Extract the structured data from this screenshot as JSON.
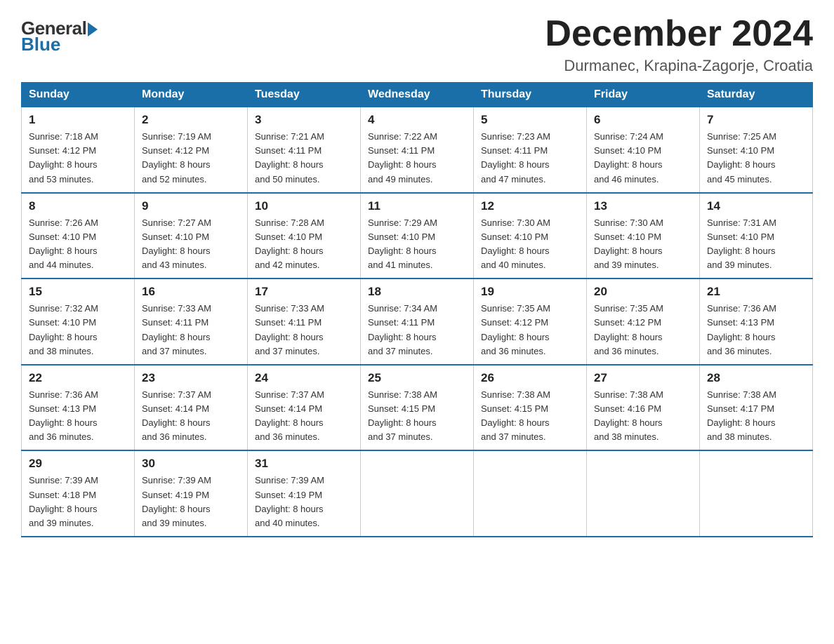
{
  "header": {
    "logo_general": "General",
    "logo_blue": "Blue",
    "month_title": "December 2024",
    "location": "Durmanec, Krapina-Zagorje, Croatia"
  },
  "weekdays": [
    "Sunday",
    "Monday",
    "Tuesday",
    "Wednesday",
    "Thursday",
    "Friday",
    "Saturday"
  ],
  "weeks": [
    [
      {
        "day": "1",
        "sunrise": "7:18 AM",
        "sunset": "4:12 PM",
        "daylight": "8 hours and 53 minutes."
      },
      {
        "day": "2",
        "sunrise": "7:19 AM",
        "sunset": "4:12 PM",
        "daylight": "8 hours and 52 minutes."
      },
      {
        "day": "3",
        "sunrise": "7:21 AM",
        "sunset": "4:11 PM",
        "daylight": "8 hours and 50 minutes."
      },
      {
        "day": "4",
        "sunrise": "7:22 AM",
        "sunset": "4:11 PM",
        "daylight": "8 hours and 49 minutes."
      },
      {
        "day": "5",
        "sunrise": "7:23 AM",
        "sunset": "4:11 PM",
        "daylight": "8 hours and 47 minutes."
      },
      {
        "day": "6",
        "sunrise": "7:24 AM",
        "sunset": "4:10 PM",
        "daylight": "8 hours and 46 minutes."
      },
      {
        "day": "7",
        "sunrise": "7:25 AM",
        "sunset": "4:10 PM",
        "daylight": "8 hours and 45 minutes."
      }
    ],
    [
      {
        "day": "8",
        "sunrise": "7:26 AM",
        "sunset": "4:10 PM",
        "daylight": "8 hours and 44 minutes."
      },
      {
        "day": "9",
        "sunrise": "7:27 AM",
        "sunset": "4:10 PM",
        "daylight": "8 hours and 43 minutes."
      },
      {
        "day": "10",
        "sunrise": "7:28 AM",
        "sunset": "4:10 PM",
        "daylight": "8 hours and 42 minutes."
      },
      {
        "day": "11",
        "sunrise": "7:29 AM",
        "sunset": "4:10 PM",
        "daylight": "8 hours and 41 minutes."
      },
      {
        "day": "12",
        "sunrise": "7:30 AM",
        "sunset": "4:10 PM",
        "daylight": "8 hours and 40 minutes."
      },
      {
        "day": "13",
        "sunrise": "7:30 AM",
        "sunset": "4:10 PM",
        "daylight": "8 hours and 39 minutes."
      },
      {
        "day": "14",
        "sunrise": "7:31 AM",
        "sunset": "4:10 PM",
        "daylight": "8 hours and 39 minutes."
      }
    ],
    [
      {
        "day": "15",
        "sunrise": "7:32 AM",
        "sunset": "4:10 PM",
        "daylight": "8 hours and 38 minutes."
      },
      {
        "day": "16",
        "sunrise": "7:33 AM",
        "sunset": "4:11 PM",
        "daylight": "8 hours and 37 minutes."
      },
      {
        "day": "17",
        "sunrise": "7:33 AM",
        "sunset": "4:11 PM",
        "daylight": "8 hours and 37 minutes."
      },
      {
        "day": "18",
        "sunrise": "7:34 AM",
        "sunset": "4:11 PM",
        "daylight": "8 hours and 37 minutes."
      },
      {
        "day": "19",
        "sunrise": "7:35 AM",
        "sunset": "4:12 PM",
        "daylight": "8 hours and 36 minutes."
      },
      {
        "day": "20",
        "sunrise": "7:35 AM",
        "sunset": "4:12 PM",
        "daylight": "8 hours and 36 minutes."
      },
      {
        "day": "21",
        "sunrise": "7:36 AM",
        "sunset": "4:13 PM",
        "daylight": "8 hours and 36 minutes."
      }
    ],
    [
      {
        "day": "22",
        "sunrise": "7:36 AM",
        "sunset": "4:13 PM",
        "daylight": "8 hours and 36 minutes."
      },
      {
        "day": "23",
        "sunrise": "7:37 AM",
        "sunset": "4:14 PM",
        "daylight": "8 hours and 36 minutes."
      },
      {
        "day": "24",
        "sunrise": "7:37 AM",
        "sunset": "4:14 PM",
        "daylight": "8 hours and 36 minutes."
      },
      {
        "day": "25",
        "sunrise": "7:38 AM",
        "sunset": "4:15 PM",
        "daylight": "8 hours and 37 minutes."
      },
      {
        "day": "26",
        "sunrise": "7:38 AM",
        "sunset": "4:15 PM",
        "daylight": "8 hours and 37 minutes."
      },
      {
        "day": "27",
        "sunrise": "7:38 AM",
        "sunset": "4:16 PM",
        "daylight": "8 hours and 38 minutes."
      },
      {
        "day": "28",
        "sunrise": "7:38 AM",
        "sunset": "4:17 PM",
        "daylight": "8 hours and 38 minutes."
      }
    ],
    [
      {
        "day": "29",
        "sunrise": "7:39 AM",
        "sunset": "4:18 PM",
        "daylight": "8 hours and 39 minutes."
      },
      {
        "day": "30",
        "sunrise": "7:39 AM",
        "sunset": "4:19 PM",
        "daylight": "8 hours and 39 minutes."
      },
      {
        "day": "31",
        "sunrise": "7:39 AM",
        "sunset": "4:19 PM",
        "daylight": "8 hours and 40 minutes."
      },
      null,
      null,
      null,
      null
    ]
  ],
  "labels": {
    "sunrise": "Sunrise:",
    "sunset": "Sunset:",
    "daylight": "Daylight:"
  }
}
